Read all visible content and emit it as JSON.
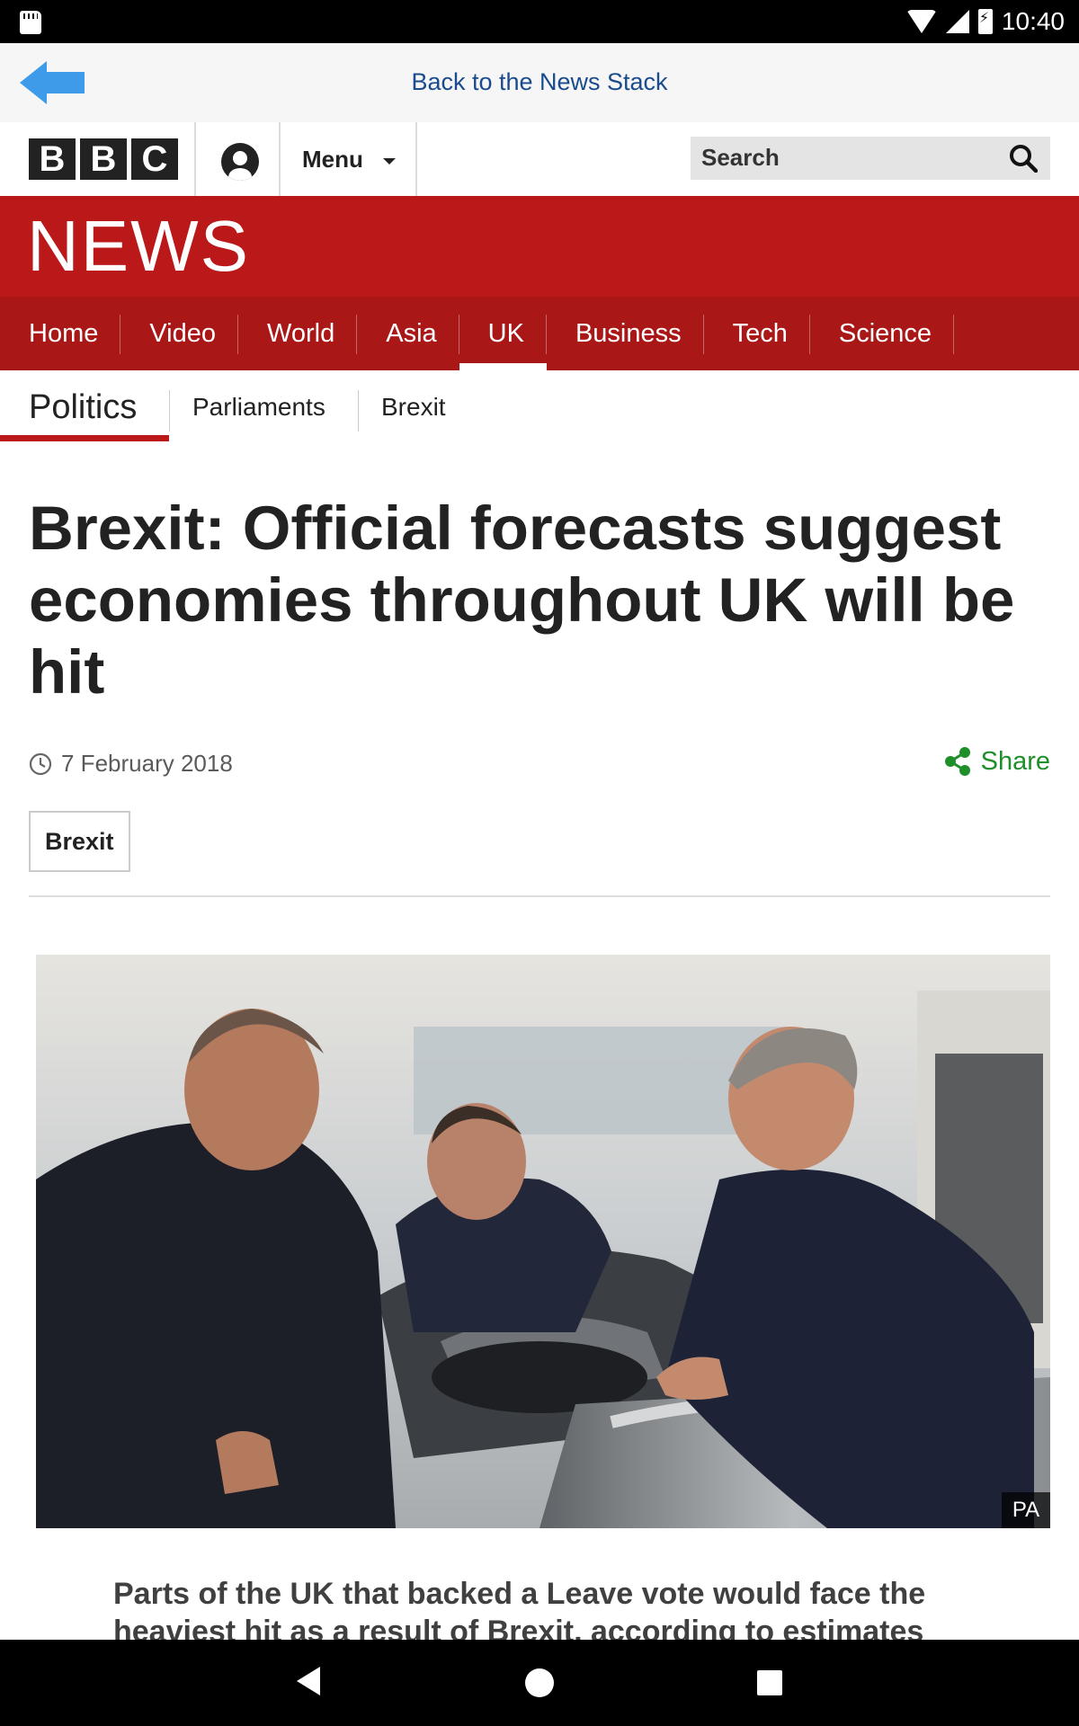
{
  "status_bar": {
    "time": "10:40"
  },
  "back_bar": {
    "label": "Back to the News Stack"
  },
  "bbc_header": {
    "logo_letters": [
      "B",
      "B",
      "C"
    ],
    "menu_label": "Menu",
    "search_placeholder": "Search"
  },
  "section_title": "NEWS",
  "nav": {
    "items": [
      {
        "label": "Home"
      },
      {
        "label": "Video"
      },
      {
        "label": "World"
      },
      {
        "label": "Asia"
      },
      {
        "label": "UK",
        "active": true
      },
      {
        "label": "Business"
      },
      {
        "label": "Tech"
      },
      {
        "label": "Science"
      }
    ]
  },
  "subnav": {
    "current": "Politics",
    "items": [
      "Parliaments",
      "Brexit"
    ]
  },
  "article": {
    "headline": "Brexit: Official forecasts suggest economies throughout UK will be hit",
    "date": "7 February 2018",
    "share_label": "Share",
    "tag": "Brexit",
    "image_credit": "PA",
    "intro": "Parts of the UK that backed a Leave vote would face the heaviest hit as a result of Brexit, according to estimates"
  },
  "colors": {
    "bbc_red": "#bb1919",
    "nav_red": "#a91717",
    "share_green": "#1f8f2a",
    "back_link_blue": "#1a4b8c"
  },
  "icons": [
    "sd-card-icon",
    "wifi-icon",
    "signal-icon",
    "battery-icon",
    "back-arrow-icon",
    "account-icon",
    "chevron-down-icon",
    "search-icon",
    "clock-icon",
    "share-icon"
  ]
}
